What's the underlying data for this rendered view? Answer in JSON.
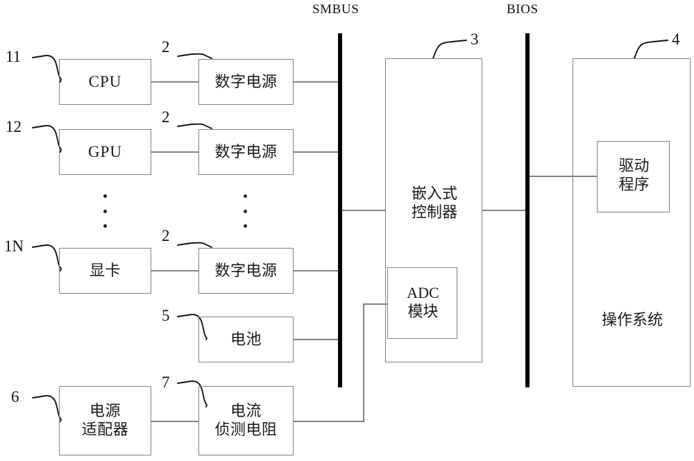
{
  "diagram": {
    "type": "block-diagram",
    "buses": [
      {
        "id": "smbus",
        "caption": "SMBUS"
      },
      {
        "id": "bios",
        "caption": "BIOS"
      }
    ],
    "reference_numbers": {
      "cpu": "11",
      "gpu": "12",
      "graphics_card": "1N",
      "digital_power_cpu": "2",
      "digital_power_gpu": "2",
      "digital_power_gfx": "2",
      "embedded_controller": "3",
      "operating_system": "4",
      "battery": "5",
      "power_adapter": "6",
      "current_sense_resistor": "7"
    },
    "blocks": {
      "cpu": "CPU",
      "gpu": "GPU",
      "graphics_card": "显卡",
      "digital_power_cpu": "数字电源",
      "digital_power_gpu": "数字电源",
      "digital_power_gfx": "数字电源",
      "battery": "电池",
      "power_adapter": "电源\n适配器",
      "current_sense_resistor": "电流\n侦测电阻",
      "embedded_controller": "嵌入式\n控制器",
      "adc_module": "ADC\n模块",
      "operating_system": "操作系统",
      "driver_program": "驱动\n程序"
    },
    "colors": {
      "box_stroke": "#808080",
      "bus": "#000000",
      "wire": "#808080",
      "leader": "#000000",
      "text": "#1a1a1a",
      "background": "#ffffff"
    }
  }
}
